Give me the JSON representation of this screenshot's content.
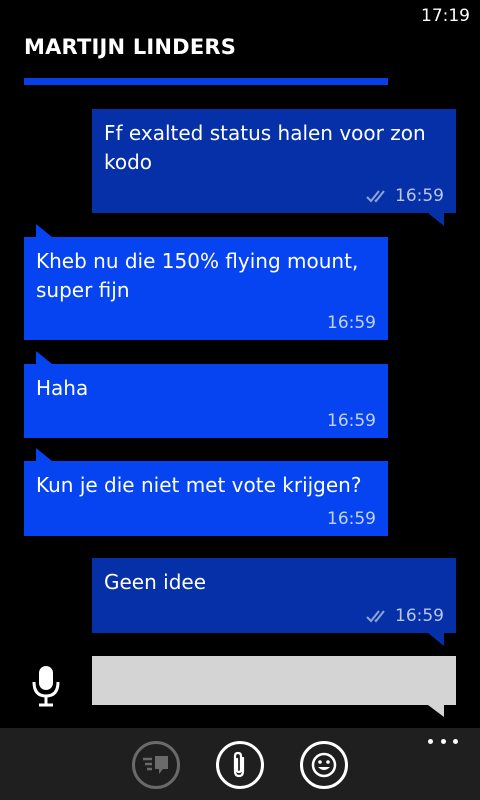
{
  "status_bar": {
    "time": "17:19"
  },
  "header": {
    "contact_name": "MARTIJN LINDERS"
  },
  "messages": [
    {
      "direction": "sent",
      "text": "Ff exalted status halen voor zon kodo",
      "time": "16:59",
      "delivered_icon": "double-check-icon"
    },
    {
      "direction": "received",
      "text": "Kheb nu die 150% flying mount, super fijn",
      "time": "16:59"
    },
    {
      "direction": "received",
      "text": "Haha",
      "time": "16:59"
    },
    {
      "direction": "received",
      "text": "Kun je die niet met vote krijgen?",
      "time": "16:59"
    },
    {
      "direction": "sent",
      "text": "Geen idee",
      "time": "16:59",
      "delivered_icon": "double-check-icon"
    }
  ],
  "compose": {
    "placeholder": "",
    "value": "",
    "mic_icon": "microphone-icon"
  },
  "app_bar": {
    "buttons": [
      {
        "icon": "switch-conversation-icon",
        "enabled": false
      },
      {
        "icon": "paperclip-icon",
        "enabled": true
      },
      {
        "icon": "emoji-icon",
        "enabled": true
      }
    ],
    "more_icon": "more-dots-icon"
  },
  "colors": {
    "sent_bubble": "#0530a8",
    "received_bubble": "#0544f0",
    "accent": "#0a3fe8",
    "compose_bg": "#d4d4d4",
    "app_bar_bg": "#1f1f1f"
  }
}
